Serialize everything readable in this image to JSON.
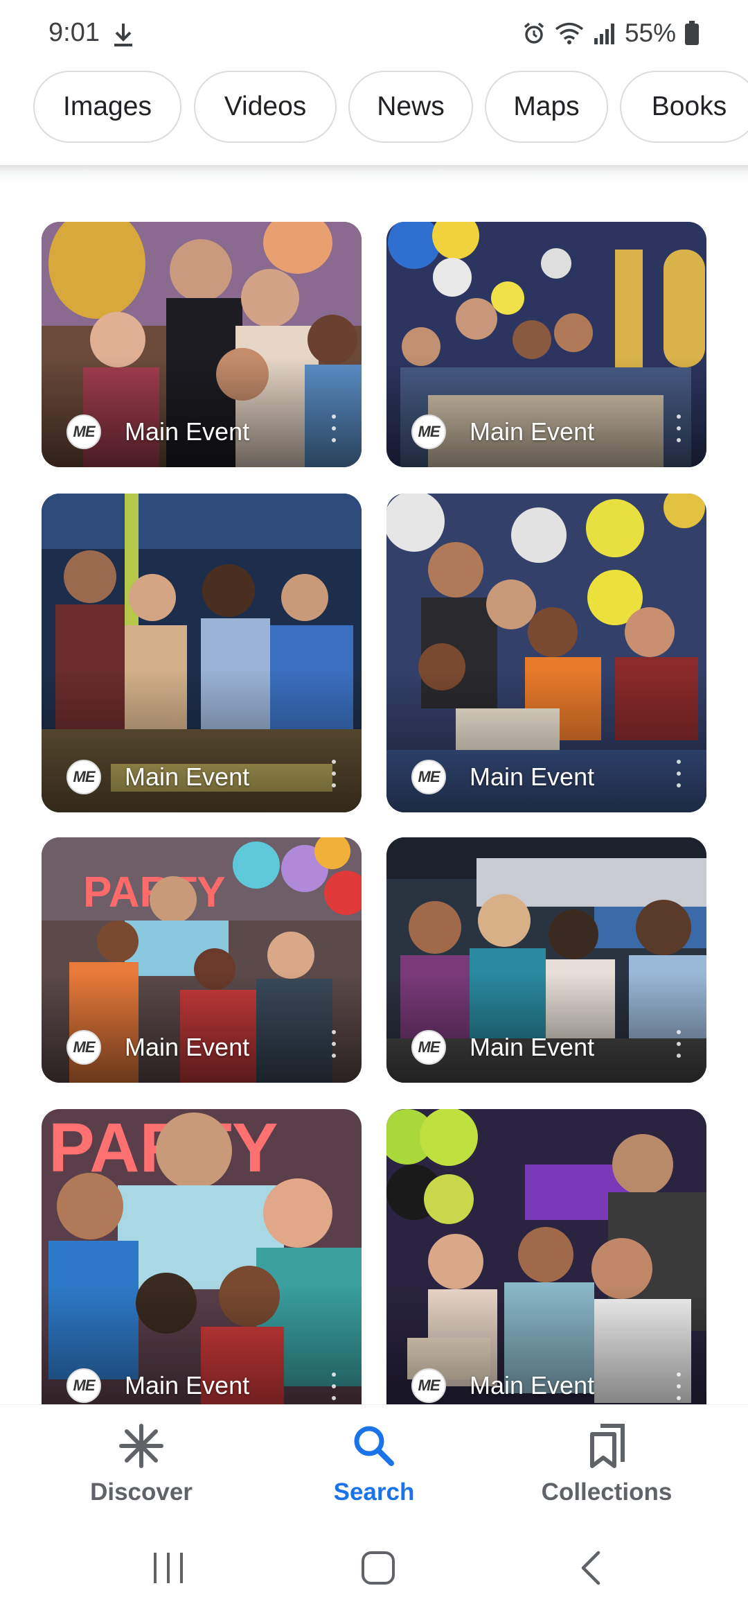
{
  "status_bar": {
    "time": "9:01",
    "battery": "55%",
    "icons": [
      "download-icon",
      "alarm-icon",
      "wifi-icon",
      "signal-icon",
      "battery-icon"
    ]
  },
  "chips": [
    "Images",
    "Videos",
    "News",
    "Maps",
    "Books"
  ],
  "results": [
    {
      "source": "Main Event",
      "logo": "ME",
      "scene": "party-gold-balloons"
    },
    {
      "source": "Main Event",
      "logo": "ME",
      "scene": "birthday-table-10-balloons"
    },
    {
      "source": "Main Event",
      "logo": "ME",
      "scene": "adults-bowling"
    },
    {
      "source": "Main Event",
      "logo": "ME",
      "scene": "family-birthday-cake"
    },
    {
      "source": "Main Event",
      "logo": "ME",
      "scene": "party-sign-group"
    },
    {
      "source": "Main Event",
      "logo": "ME",
      "scene": "women-drinks"
    },
    {
      "source": "Main Event",
      "logo": "ME",
      "scene": "party-kids-hats"
    },
    {
      "source": "Main Event",
      "logo": "ME",
      "scene": "teens-party-hats"
    }
  ],
  "bottom_nav": {
    "discover": "Discover",
    "search": "Search",
    "collections": "Collections",
    "active": "Search"
  },
  "colors": {
    "accent": "#1a73e8",
    "chip_border": "#dadce0",
    "nav_inactive": "#5f6368"
  }
}
